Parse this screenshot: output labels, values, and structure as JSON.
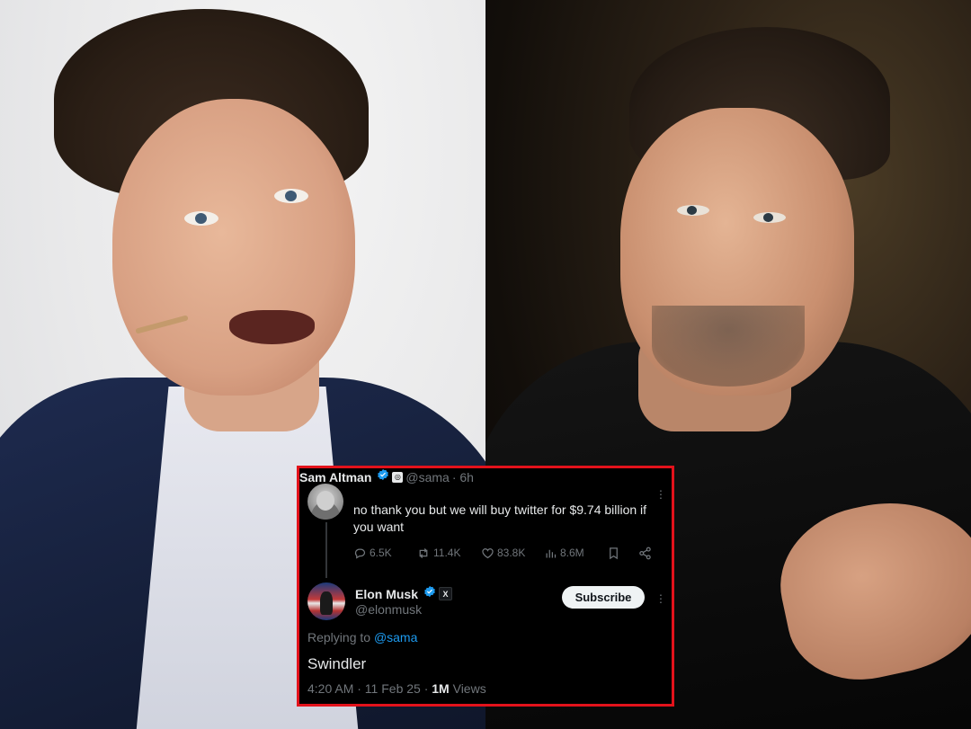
{
  "tweet": {
    "author_name": "Sam Altman",
    "author_handle": "@sama",
    "time_ago": "· 6h",
    "text": "no thank you but we will buy twitter for $9.74 billion if you want",
    "replies": "6.5K",
    "reposts": "11.4K",
    "likes": "83.8K",
    "views": "8.6M",
    "icons": [
      "verified-badge-icon",
      "org-badge-icon",
      "reply-icon",
      "repost-icon",
      "like-icon",
      "views-icon",
      "bookmark-icon",
      "share-icon",
      "more-icon"
    ]
  },
  "reply": {
    "author_name": "Elon Musk",
    "author_handle": "@elonmusk",
    "subscribe_label": "Subscribe",
    "replying_prefix": "Replying to",
    "replying_to": "@sama",
    "text": "Swindler",
    "time": "4:20 AM · 11 Feb 25 · ",
    "views_count": "1M",
    "views_label": " Views",
    "badge_label": "X"
  },
  "colors": {
    "card_border": "#e3121b",
    "verified": "#1d9bf0",
    "mention": "#1d9bf0",
    "card_bg": "#000000"
  }
}
